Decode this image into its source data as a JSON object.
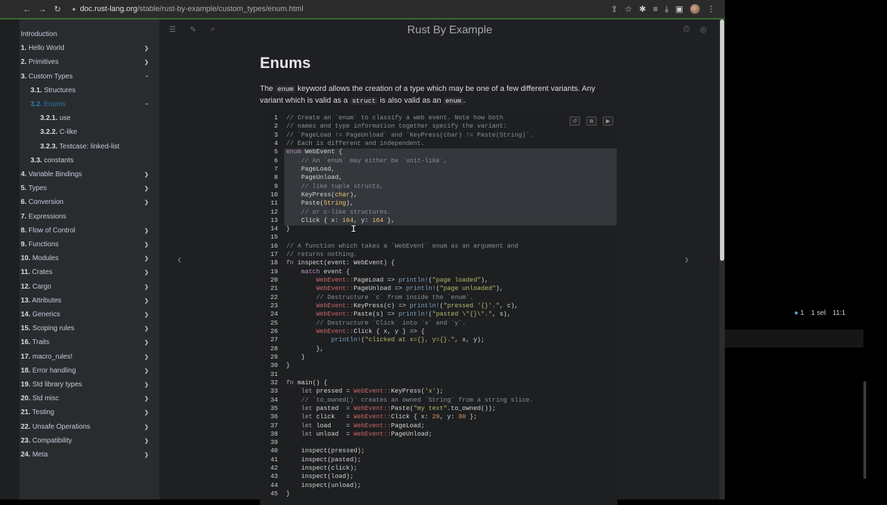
{
  "browser": {
    "url_domain": "doc.rust-lang.org",
    "url_path": "/stable/rust-by-example/custom_types/enum.html",
    "back_icon": "←",
    "forward_icon": "→",
    "reload_icon": "↻"
  },
  "sidebar": {
    "items": [
      {
        "num": "",
        "label": "Introduction",
        "toggle": ""
      },
      {
        "num": "1.",
        "label": "Hello World",
        "toggle": "❯"
      },
      {
        "num": "2.",
        "label": "Primitives",
        "toggle": "❯"
      },
      {
        "num": "3.",
        "label": "Custom Types",
        "toggle": "⌄"
      },
      {
        "num": "3.1.",
        "label": "Structures",
        "toggle": ""
      },
      {
        "num": "3.2.",
        "label": "Enums",
        "toggle": "⌄"
      },
      {
        "num": "3.2.1.",
        "label": "use",
        "toggle": ""
      },
      {
        "num": "3.2.2.",
        "label": "C-like",
        "toggle": ""
      },
      {
        "num": "3.2.3.",
        "label": "Testcase: linked-list",
        "toggle": ""
      },
      {
        "num": "3.3.",
        "label": "constants",
        "toggle": ""
      },
      {
        "num": "4.",
        "label": "Variable Bindings",
        "toggle": "❯"
      },
      {
        "num": "5.",
        "label": "Types",
        "toggle": "❯"
      },
      {
        "num": "6.",
        "label": "Conversion",
        "toggle": "❯"
      },
      {
        "num": "7.",
        "label": "Expressions",
        "toggle": ""
      },
      {
        "num": "8.",
        "label": "Flow of Control",
        "toggle": "❯"
      },
      {
        "num": "9.",
        "label": "Functions",
        "toggle": "❯"
      },
      {
        "num": "10.",
        "label": "Modules",
        "toggle": "❯"
      },
      {
        "num": "11.",
        "label": "Crates",
        "toggle": "❯"
      },
      {
        "num": "12.",
        "label": "Cargo",
        "toggle": "❯"
      },
      {
        "num": "13.",
        "label": "Attributes",
        "toggle": "❯"
      },
      {
        "num": "14.",
        "label": "Generics",
        "toggle": "❯"
      },
      {
        "num": "15.",
        "label": "Scoping rules",
        "toggle": "❯"
      },
      {
        "num": "16.",
        "label": "Traits",
        "toggle": "❯"
      },
      {
        "num": "17.",
        "label": "macro_rules!",
        "toggle": "❯"
      },
      {
        "num": "18.",
        "label": "Error handling",
        "toggle": "❯"
      },
      {
        "num": "19.",
        "label": "Std library types",
        "toggle": "❯"
      },
      {
        "num": "20.",
        "label": "Std misc",
        "toggle": "❯"
      },
      {
        "num": "21.",
        "label": "Testing",
        "toggle": "❯"
      },
      {
        "num": "22.",
        "label": "Unsafe Operations",
        "toggle": "❯"
      },
      {
        "num": "23.",
        "label": "Compatibility",
        "toggle": "❯"
      },
      {
        "num": "24.",
        "label": "Meta",
        "toggle": "❯"
      }
    ]
  },
  "header": {
    "book_title": "Rust By Example"
  },
  "page": {
    "heading": "Enums",
    "intro_1": "The ",
    "intro_code_1": "enum",
    "intro_2": " keyword allows the creation of a type which may be one of a few different variants. Any variant which is valid as a ",
    "intro_code_2": "struct",
    "intro_3": " is also valid as an ",
    "intro_code_3": "enum",
    "intro_4": "."
  },
  "code": {
    "lines": [
      "// Create an `enum` to classify a web event. Note how both",
      "// names and type information together specify the variant:",
      "// `PageLoad != PageUnload` and `KeyPress(char) != Paste(String)`.",
      "// Each is different and independent.",
      "enum WebEvent {",
      "    // An `enum` may either be `unit-like`,",
      "    PageLoad,",
      "    PageUnload,",
      "    // like tuple structs,",
      "    KeyPress(char),",
      "    Paste(String),",
      "    // or c-like structures.",
      "    Click { x: i64, y: i64 },",
      "}",
      "",
      "// A function which takes a `WebEvent` enum as an argument and",
      "// returns nothing.",
      "fn inspect(event: WebEvent) {",
      "    match event {",
      "        WebEvent::PageLoad => println!(\"page loaded\"),",
      "        WebEvent::PageUnload => println!(\"page unloaded\"),",
      "        // Destructure `c` from inside the `enum`.",
      "        WebEvent::KeyPress(c) => println!(\"pressed '{}'.\", c),",
      "        WebEvent::Paste(s) => println!(\"pasted \\\"{}\\\".\", s),",
      "        // Destructure `Click` into `x` and `y`.",
      "        WebEvent::Click { x, y } => {",
      "            println!(\"clicked at x={}, y={}.\", x, y);",
      "        },",
      "    }",
      "}",
      "",
      "fn main() {",
      "    let pressed = WebEvent::KeyPress('x');",
      "    // `to_owned()` creates an owned `String` from a string slice.",
      "    let pasted  = WebEvent::Paste(\"my text\".to_owned());",
      "    let click   = WebEvent::Click { x: 20, y: 80 };",
      "    let load    = WebEvent::PageLoad;",
      "    let unload  = WebEvent::PageUnload;",
      "",
      "    inspect(pressed);",
      "    inspect(pasted);",
      "    inspect(click);",
      "    inspect(load);",
      "    inspect(unload);",
      "}"
    ]
  },
  "editor_status": {
    "line_count": "1",
    "selection": "1 sel",
    "position": "11:1"
  },
  "colors": {
    "active_link": "#2b79a2",
    "sidebar_bg": "#292c2f",
    "content_bg": "#1f2023"
  }
}
